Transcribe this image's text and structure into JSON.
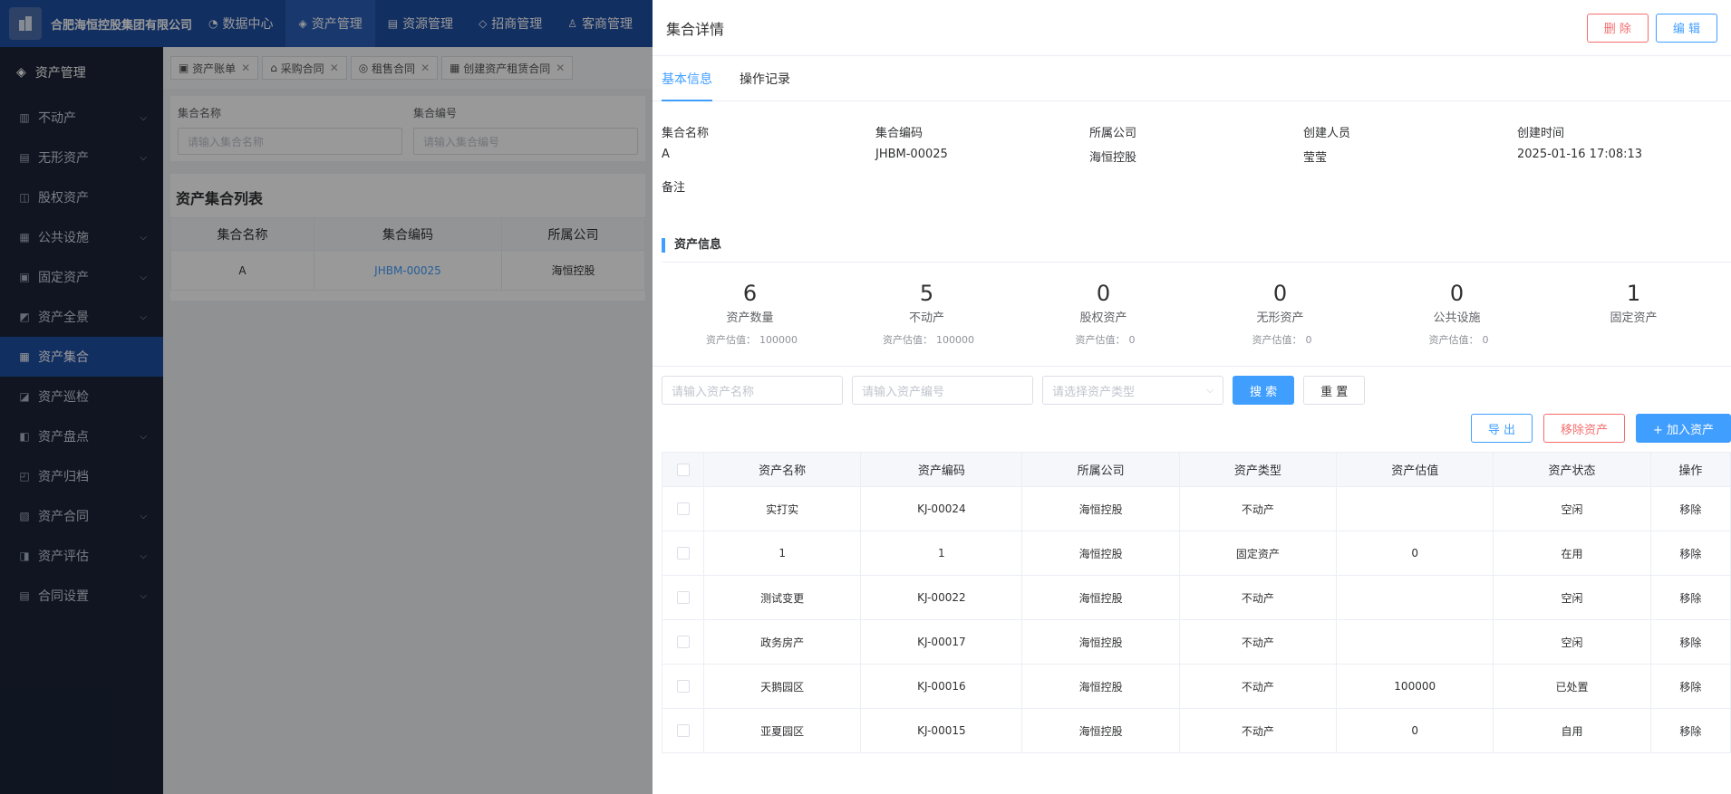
{
  "topbar": {
    "brand": "合肥海恒控股集团有限公司",
    "nav": [
      {
        "label": "数据中心",
        "icon": "dashboard-icon"
      },
      {
        "label": "资产管理",
        "icon": "cube-icon"
      },
      {
        "label": "资源管理",
        "icon": "building-icon"
      },
      {
        "label": "招商管理",
        "icon": "tag-icon"
      },
      {
        "label": "客商管理",
        "icon": "user-icon"
      }
    ]
  },
  "sidebar": {
    "title": "资产管理",
    "items": [
      {
        "label": "不动产",
        "expandable": true
      },
      {
        "label": "无形资产",
        "expandable": true
      },
      {
        "label": "股权资产",
        "expandable": false
      },
      {
        "label": "公共设施",
        "expandable": true
      },
      {
        "label": "固定资产",
        "expandable": true
      },
      {
        "label": "资产全景",
        "expandable": true
      },
      {
        "label": "资产集合",
        "expandable": false,
        "active": true
      },
      {
        "label": "资产巡检",
        "expandable": false
      },
      {
        "label": "资产盘点",
        "expandable": true
      },
      {
        "label": "资产归档",
        "expandable": false
      },
      {
        "label": "资产合同",
        "expandable": true
      },
      {
        "label": "资产评估",
        "expandable": true
      },
      {
        "label": "合同设置",
        "expandable": true
      }
    ]
  },
  "page_tabs": [
    "资产账单",
    "采购合同",
    "租售合同",
    "创建资产租赁合同"
  ],
  "filters": {
    "name_label": "集合名称",
    "name_placeholder": "请输入集合名称",
    "code_label": "集合编号",
    "code_placeholder": "请输入集合编号"
  },
  "list": {
    "title": "资产集合列表",
    "headers": [
      "集合名称",
      "集合编码",
      "所属公司"
    ],
    "row": [
      "A",
      "JHBM-00025",
      "海恒控股"
    ]
  },
  "drawer": {
    "title": "集合详情",
    "delete_label": "删 除",
    "edit_label": "编 辑",
    "tabs": [
      "基本信息",
      "操作记录"
    ],
    "info": [
      {
        "k": "集合名称",
        "v": "A"
      },
      {
        "k": "集合编码",
        "v": "JHBM-00025"
      },
      {
        "k": "所属公司",
        "v": "海恒控股"
      },
      {
        "k": "创建人员",
        "v": "莹莹"
      },
      {
        "k": "创建时间",
        "v": "2025-01-16 17:08:13"
      },
      {
        "k": "备注",
        "v": ""
      }
    ],
    "section_title": "资产信息",
    "stats": [
      {
        "num": "6",
        "label": "资产数量",
        "sub_label": "资产估值：",
        "sub_value": "100000"
      },
      {
        "num": "5",
        "label": "不动产",
        "sub_label": "资产估值：",
        "sub_value": "100000"
      },
      {
        "num": "0",
        "label": "股权资产",
        "sub_label": "资产估值：",
        "sub_value": "0"
      },
      {
        "num": "0",
        "label": "无形资产",
        "sub_label": "资产估值：",
        "sub_value": "0"
      },
      {
        "num": "0",
        "label": "公共设施",
        "sub_label": "资产估值：",
        "sub_value": "0"
      },
      {
        "num": "1",
        "label": "固定资产",
        "sub_label": "",
        "sub_value": ""
      }
    ],
    "search": {
      "name_placeholder": "请输入资产名称",
      "code_placeholder": "请输入资产编号",
      "type_placeholder": "请选择资产类型",
      "search_label": "搜 索",
      "reset_label": "重 置"
    },
    "actions": {
      "export_label": "导 出",
      "remove_label": "移除资产",
      "add_label": "+ 加入资产"
    },
    "table": {
      "headers": [
        "资产名称",
        "资产编码",
        "所属公司",
        "资产类型",
        "资产估值",
        "资产状态",
        "操作"
      ],
      "rows": [
        {
          "name": "实打实",
          "code": "KJ-00024",
          "company": "海恒控股",
          "type": "不动产",
          "type_color": "blue",
          "value": "",
          "status": "空闲",
          "op": "移除"
        },
        {
          "name": "1",
          "code": "1",
          "company": "海恒控股",
          "type": "固定资产",
          "type_color": "red",
          "value": "0",
          "status": "在用",
          "op": "移除"
        },
        {
          "name": "测试变更",
          "code": "KJ-00022",
          "company": "海恒控股",
          "type": "不动产",
          "type_color": "blue",
          "value": "",
          "status": "空闲",
          "op": "移除"
        },
        {
          "name": "政务房产",
          "code": "KJ-00017",
          "company": "海恒控股",
          "type": "不动产",
          "type_color": "blue",
          "value": "",
          "status": "空闲",
          "op": "移除"
        },
        {
          "name": "天鹅园区",
          "code": "KJ-00016",
          "company": "海恒控股",
          "type": "不动产",
          "type_color": "blue",
          "value": "100000",
          "status": "已处置",
          "op": "移除"
        },
        {
          "name": "亚夏园区",
          "code": "KJ-00015",
          "company": "海恒控股",
          "type": "不动产",
          "type_color": "blue",
          "value": "0",
          "status": "自用",
          "op": "移除"
        }
      ]
    }
  }
}
